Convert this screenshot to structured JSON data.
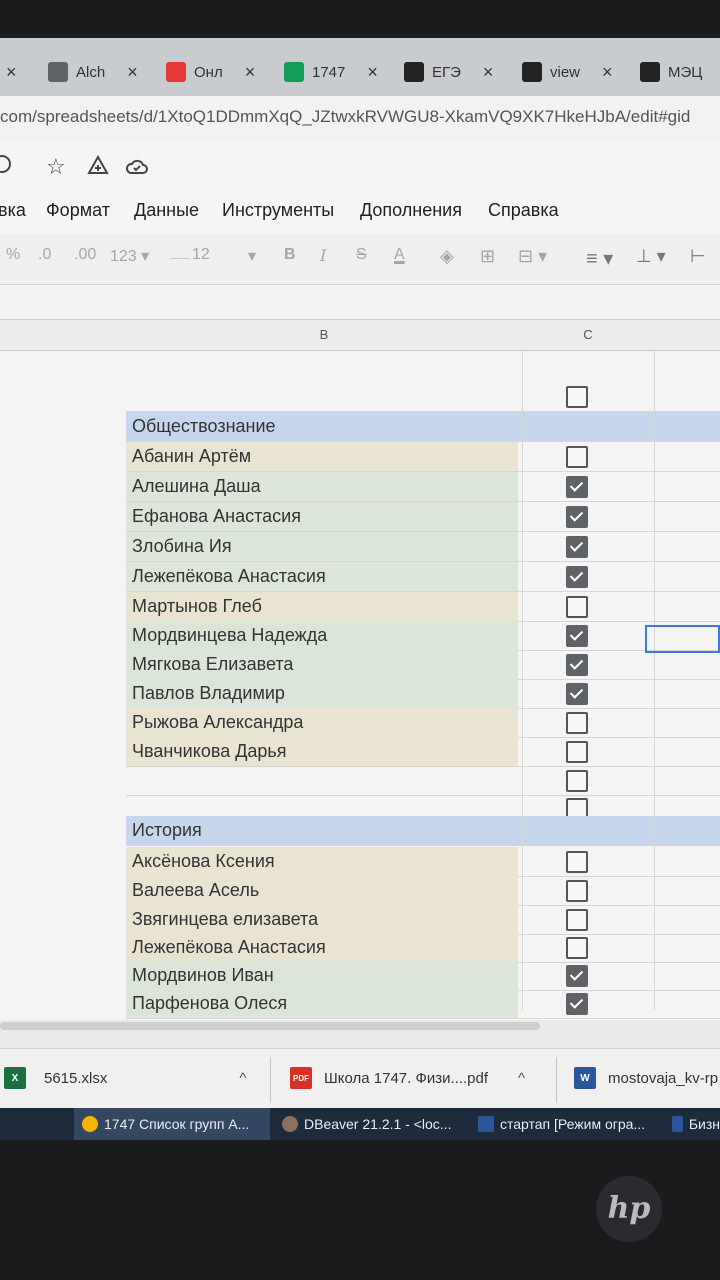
{
  "browser": {
    "tabs": [
      {
        "title": "Alch",
        "icon": "globe-icon",
        "color": "#5f6368"
      },
      {
        "title": "Онл",
        "icon": "ozon-icon",
        "color": "#e53935"
      },
      {
        "title": "1747",
        "icon": "sheets-icon",
        "color": "#0f9d58"
      },
      {
        "title": "ЕГЭ",
        "icon": "k-icon",
        "color": "#222222"
      },
      {
        "title": "view",
        "icon": "k-icon",
        "color": "#222222"
      },
      {
        "title": "МЭЦ",
        "icon": "m-icon",
        "color": "#222222"
      }
    ],
    "tab_close": "×",
    "url": "com/spreadsheets/d/1XtoQ1DDmmXqQ_JZtwxkRVWGU8-XkamVQ9XK7HkeHJbA/edit#gid"
  },
  "docs": {
    "menu": [
      "вка",
      "Формат",
      "Данные",
      "Инструменты",
      "Дополнения",
      "Справка"
    ],
    "toolbar": {
      "percent": "%",
      "dec_less": ".0",
      "dec_more": ".00",
      "format": "123",
      "font_size": "12",
      "bold": "B",
      "italic": "I",
      "strike": "S",
      "text_color": "A"
    }
  },
  "sheet": {
    "columns": [
      "B",
      "C"
    ],
    "rows": [
      {
        "type": "empty",
        "name": "",
        "checked": false,
        "has_checkbox": true,
        "color": "none"
      },
      {
        "type": "section",
        "name": "Обществознание",
        "has_checkbox": false
      },
      {
        "type": "person",
        "name": "Абанин Артём",
        "checked": false,
        "has_checkbox": true,
        "color": "beige"
      },
      {
        "type": "person",
        "name": "Алешина Даша",
        "checked": true,
        "has_checkbox": true,
        "color": "green"
      },
      {
        "type": "person",
        "name": "Ефанова Анастасия",
        "checked": true,
        "has_checkbox": true,
        "color": "green"
      },
      {
        "type": "person",
        "name": "Злобина Ия",
        "checked": true,
        "has_checkbox": true,
        "color": "green"
      },
      {
        "type": "person",
        "name": "Лежепёкова Анастасия",
        "checked": true,
        "has_checkbox": true,
        "color": "green"
      },
      {
        "type": "person",
        "name": "Мартынов Глеб",
        "checked": false,
        "has_checkbox": true,
        "color": "beige"
      },
      {
        "type": "person",
        "name": "Мордвинцева Надежда",
        "checked": true,
        "has_checkbox": true,
        "color": "green"
      },
      {
        "type": "person",
        "name": "Мягкова Елизавета",
        "checked": true,
        "has_checkbox": true,
        "color": "green"
      },
      {
        "type": "person",
        "name": "Павлов Владимир",
        "checked": true,
        "has_checkbox": true,
        "color": "green"
      },
      {
        "type": "person",
        "name": "Рыжова Александра",
        "checked": false,
        "has_checkbox": true,
        "color": "beige"
      },
      {
        "type": "person",
        "name": "Чванчикова Дарья",
        "checked": false,
        "has_checkbox": true,
        "color": "beige"
      },
      {
        "type": "empty",
        "name": "",
        "checked": false,
        "has_checkbox": true,
        "color": "none"
      },
      {
        "type": "empty",
        "name": "",
        "checked": false,
        "has_checkbox": true,
        "color": "none"
      },
      {
        "type": "section",
        "name": "История",
        "has_checkbox": false
      },
      {
        "type": "person",
        "name": "Аксёнова Ксения",
        "checked": false,
        "has_checkbox": true,
        "color": "beige"
      },
      {
        "type": "person",
        "name": "Валеева Асель",
        "checked": false,
        "has_checkbox": true,
        "color": "beige"
      },
      {
        "type": "person",
        "name": "Звягинцева елизавета",
        "checked": false,
        "has_checkbox": true,
        "color": "beige"
      },
      {
        "type": "person",
        "name": "Лежепёкова Анастасия",
        "checked": false,
        "has_checkbox": true,
        "color": "beige"
      },
      {
        "type": "person",
        "name": "Мордвинов Иван",
        "checked": true,
        "has_checkbox": true,
        "color": "green"
      },
      {
        "type": "person",
        "name": "Парфенова Олеся",
        "checked": true,
        "has_checkbox": true,
        "color": "green"
      }
    ],
    "colors": {
      "beige": "#e9e4d2",
      "green": "#dbe5d8",
      "section": "#c6d6ec"
    }
  },
  "downloads": [
    {
      "name": "5615.xlsx",
      "icon": "excel-icon",
      "color": "#1d6f42"
    },
    {
      "name": "Школа 1747. Физи....pdf",
      "icon": "pdf-icon",
      "color": "#d93025"
    },
    {
      "name": "mostovaja_kv-rp",
      "icon": "word-icon",
      "color": "#2b579a"
    }
  ],
  "download_chevron": "^",
  "taskbar": [
    {
      "label": "1747 Список групп А...",
      "icon": "chrome-icon",
      "color": "#f4b400"
    },
    {
      "label": "DBeaver 21.2.1 - <loc...",
      "icon": "dbeaver-icon",
      "color": "#8d6e63"
    },
    {
      "label": "стартап [Режим огра...",
      "icon": "word-icon",
      "color": "#2b579a"
    },
    {
      "label": "Бизн",
      "icon": "word-icon",
      "color": "#2b579a"
    }
  ],
  "hardware": {
    "logo": "hp"
  }
}
